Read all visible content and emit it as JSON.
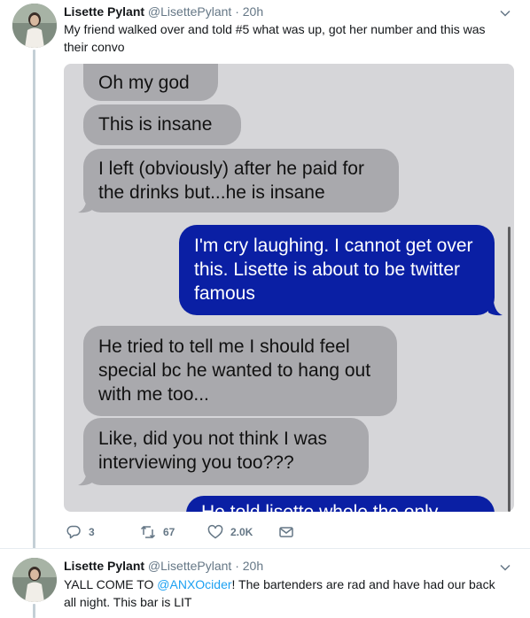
{
  "tweets": [
    {
      "name": "Lisette Pylant",
      "handle": "@LisettePylant",
      "separator": "·",
      "time": "20h",
      "text": "My friend walked over and told #5 what was up, got her number and this was their convo",
      "media": {
        "messages": [
          {
            "direction": "incoming",
            "text": "Oh my god"
          },
          {
            "direction": "incoming",
            "text": "This is insane"
          },
          {
            "direction": "incoming",
            "text": "I left (obviously) after he paid for the drinks but...he is insane"
          },
          {
            "direction": "outgoing",
            "text": "I'm cry laughing. I cannot get over this. Lisette is about to be twitter famous"
          },
          {
            "direction": "incoming",
            "text": "He tried to tell me I should feel special bc he wanted to hang out with me too..."
          },
          {
            "direction": "incoming",
            "text": "Like, did you not think I was interviewing you too???"
          },
          {
            "direction": "outgoing",
            "text": "He told lisette whole the only"
          }
        ],
        "colors": {
          "incoming": "#a9a9ad",
          "outgoing": "#0a1fa4",
          "background": "#d6d6d9"
        }
      },
      "actions": {
        "reply_count": "3",
        "retweet_count": "67",
        "like_count": "2.0K"
      }
    },
    {
      "name": "Lisette Pylant",
      "handle": "@LisettePylant",
      "separator": "·",
      "time": "20h",
      "text_before": "YALL COME TO ",
      "mention": "@ANXOcider",
      "text_after": "! The bartenders are rad and have had our back all night. This bar is LIT"
    }
  ],
  "icons": [
    "avatar",
    "chevron-down-icon",
    "reply-icon",
    "retweet-icon",
    "like-icon",
    "message-icon"
  ],
  "colors": {
    "link": "#1da1f2",
    "secondary_text": "#657786",
    "thread_line": "#c4cfd6"
  }
}
